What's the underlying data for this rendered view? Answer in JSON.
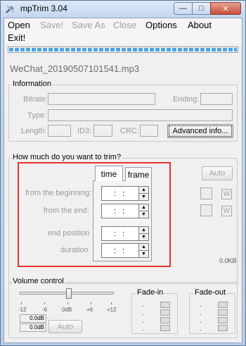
{
  "window": {
    "title": "mpTrim 3.04",
    "minimize_glyph": "—",
    "maximize_glyph": "□",
    "close_glyph": "✕"
  },
  "menu": {
    "open": "Open",
    "save": "Save!",
    "save_as": "Save As",
    "close": "Close",
    "options": "Options",
    "about": "About",
    "exit": "Exit!"
  },
  "file": {
    "name": "WeChat_20190507101541.mp3"
  },
  "information": {
    "title": "Information",
    "bitrate_label": "Bitrate:",
    "ending_label": "Ending:",
    "type_label": "Type:",
    "length_label": "Length:",
    "id3_label": "ID3:",
    "crc_label": "CRC:",
    "advanced_button": "Advanced info..."
  },
  "trim": {
    "title": "How much do you want to trim?",
    "tab_time": "time",
    "tab_frame": "frame",
    "from_beginning_label": "from the beginning:",
    "from_end_label": "from the end:",
    "end_position_label": "end position",
    "duration_label": "duration",
    "from_beginning_value": ": :",
    "from_end_value": ": :",
    "end_position_value": ": :",
    "duration_value": ": :",
    "auto_button": "Auto",
    "w_label_1": "W",
    "w_label_2": "W",
    "size_readout": "0.0KB"
  },
  "volume": {
    "title": "Volume control",
    "scale": [
      "-12",
      "-6",
      "0dB",
      "+6",
      "+12"
    ],
    "left_db": "0.0dB",
    "right_db": "0.0dB",
    "auto_button": "Auto",
    "slider_level_db": 0
  },
  "fade_in": {
    "title": "Fade-in"
  },
  "fade_out": {
    "title": "Fade-out"
  },
  "colors": {
    "highlight_box": "#e8322e",
    "progress": "#4aa3e8"
  },
  "icons": {
    "app": "tools-icon",
    "spin_up": "▲",
    "spin_down": "▼"
  }
}
